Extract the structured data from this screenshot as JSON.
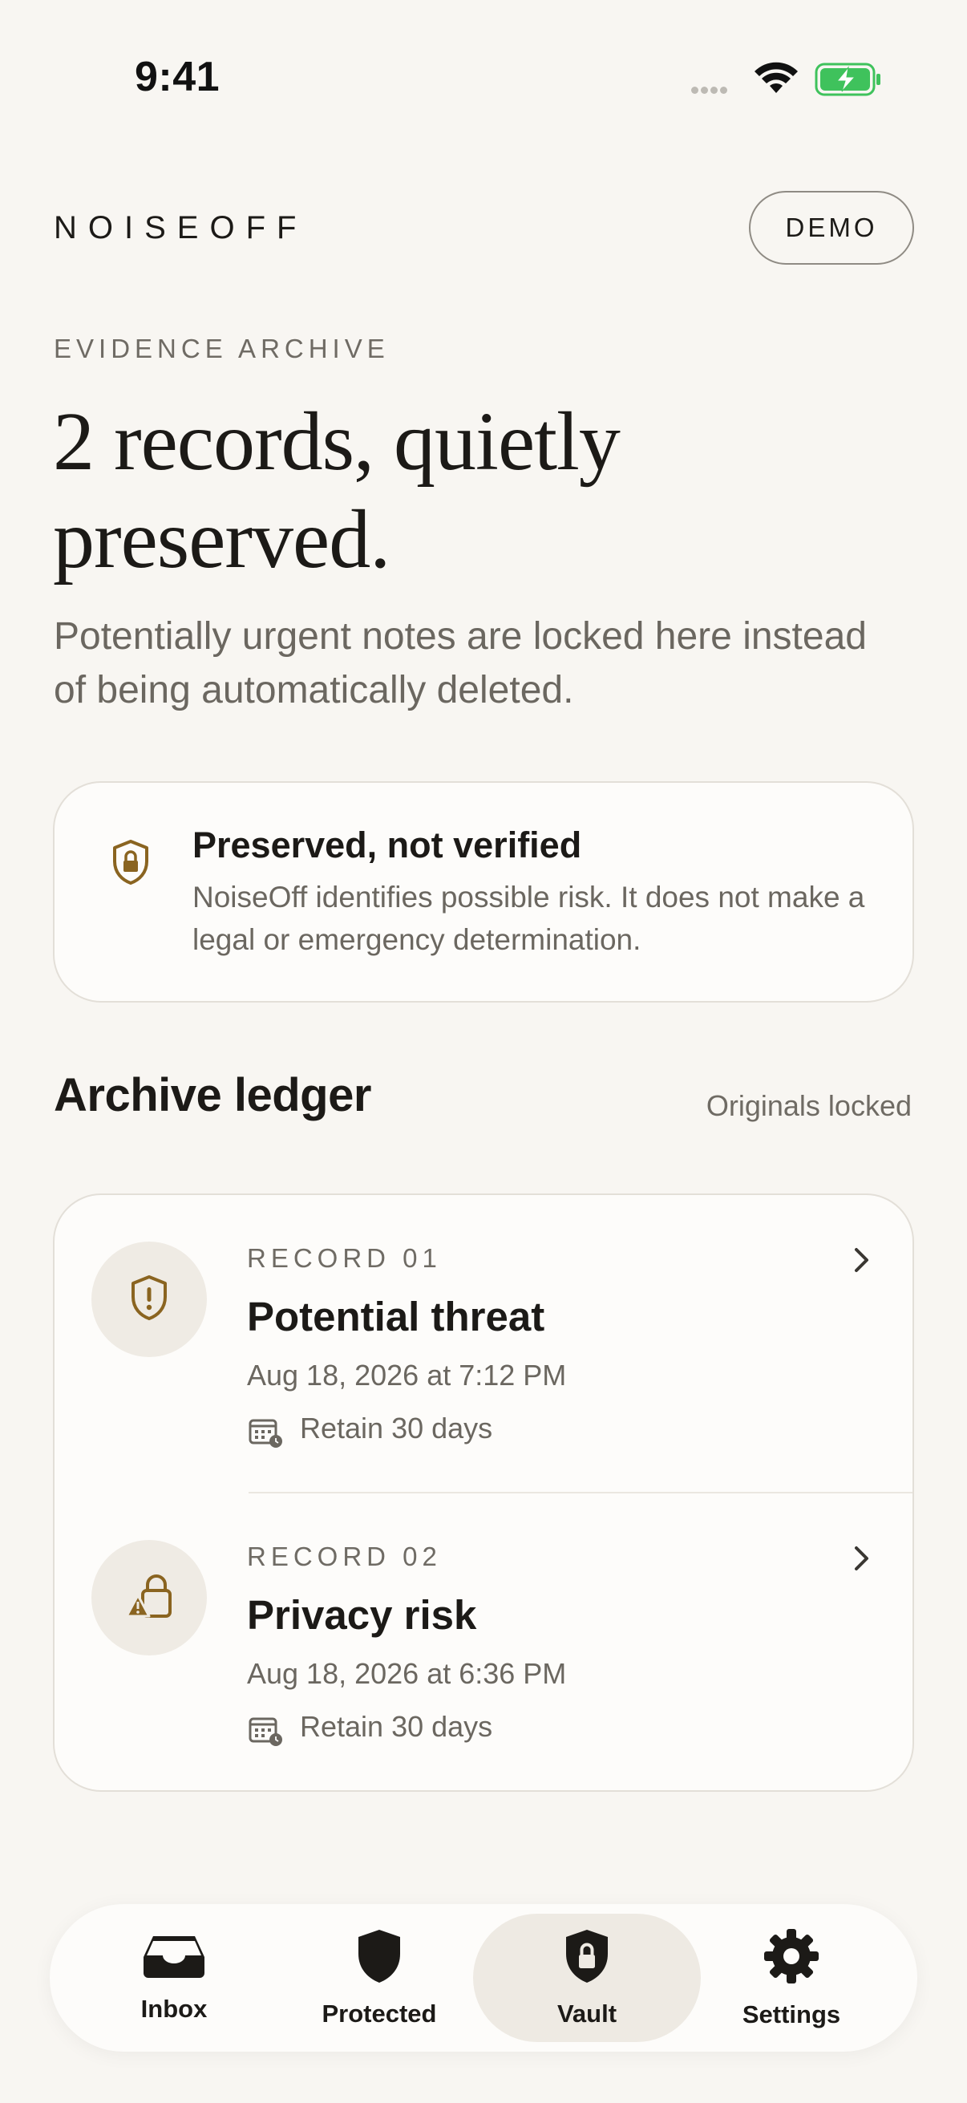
{
  "status_bar": {
    "time": "9:41"
  },
  "header": {
    "brand": "NOISEOFF",
    "demo_label": "DEMO"
  },
  "hero": {
    "eyebrow": "EVIDENCE ARCHIVE",
    "headline": "2 records, quietly preserved.",
    "subtitle": "Potentially urgent notes are locked here instead of being automatically deleted."
  },
  "notice": {
    "icon": "shield-lock-icon",
    "title": "Preserved, not verified",
    "body": "NoiseOff identifies possible risk. It does not make a legal or emergency determination."
  },
  "ledger": {
    "title": "Archive ledger",
    "aside": "Originals locked",
    "records": [
      {
        "label": "RECORD 01",
        "title": "Potential threat",
        "date": "Aug 18, 2026 at 7:12 PM",
        "retain": "Retain 30 days",
        "icon": "shield-alert-icon"
      },
      {
        "label": "RECORD 02",
        "title": "Privacy risk",
        "date": "Aug 18, 2026 at 6:36 PM",
        "retain": "Retain 30 days",
        "icon": "lock-warning-icon"
      }
    ]
  },
  "tabs": [
    {
      "label": "Inbox",
      "icon": "inbox-icon",
      "active": false
    },
    {
      "label": "Protected",
      "icon": "shield-icon",
      "active": false
    },
    {
      "label": "Vault",
      "icon": "vault-lock-icon",
      "active": true
    },
    {
      "label": "Settings",
      "icon": "gear-icon",
      "active": false
    }
  ],
  "colors": {
    "accent": "#8a6420",
    "background": "#f8f6f2",
    "battery": "#3fc25c"
  }
}
